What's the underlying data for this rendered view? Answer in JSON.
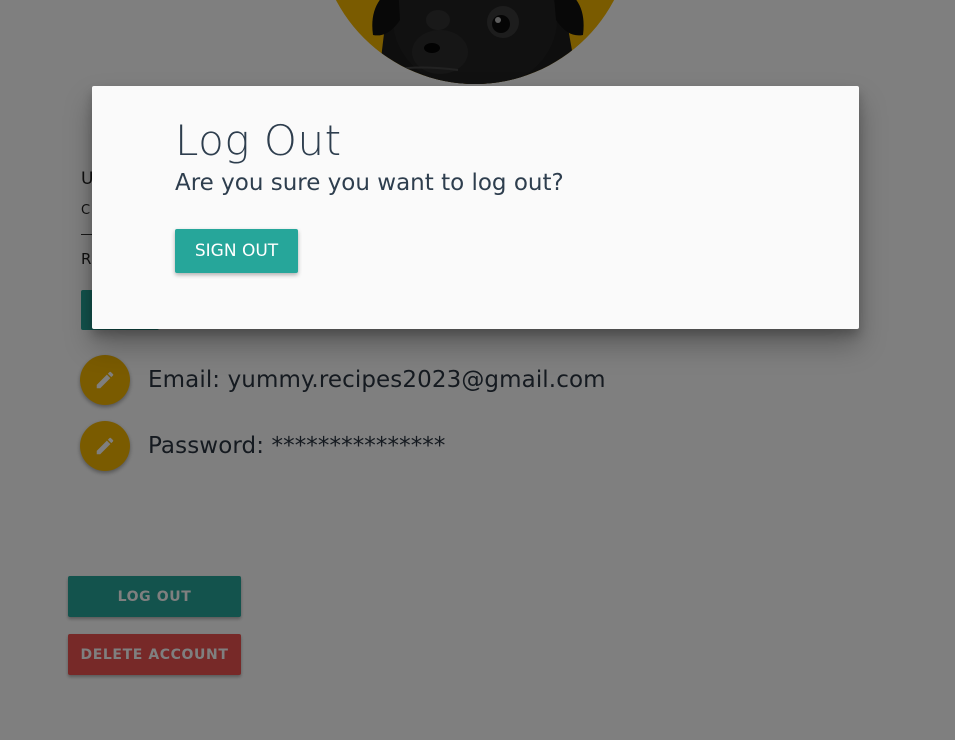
{
  "profile": {
    "avatar_alt": "pug-photo",
    "fields": [
      {
        "label": "Email: yummy.recipes2023@gmail.com"
      },
      {
        "label": "Password: ***************"
      }
    ],
    "partial_labels": [
      "U",
      "C",
      "R"
    ],
    "buttons": {
      "logout": "LOG OUT",
      "delete": "DELETE ACCOUNT"
    }
  },
  "modal": {
    "title": "Log Out",
    "message": "Are you sure you want to log out?",
    "confirm_label": "SIGN OUT"
  },
  "colors": {
    "accent_teal": "#26a69a",
    "accent_yellow": "#f5b700",
    "danger_red": "#ef5350",
    "text_dark": "#2e3e4e",
    "overlay": "rgba(0,0,0,0.5)"
  },
  "icons": {
    "edit": "pencil-icon"
  }
}
